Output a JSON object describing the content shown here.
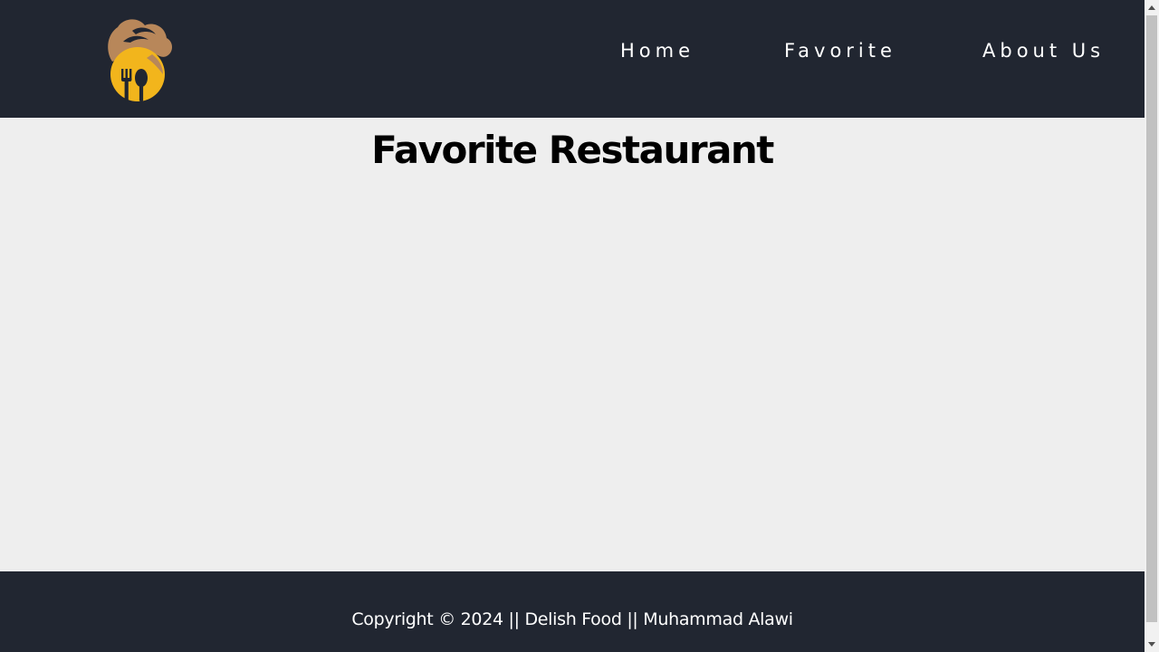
{
  "brand": {
    "logo_icon": "chef-hat-fork-spoon-logo",
    "colors": {
      "logo_hat": "#B8875A",
      "logo_plate": "#F2B51C",
      "logo_dark": "#212631"
    }
  },
  "nav": {
    "items": [
      {
        "label": "Home"
      },
      {
        "label": "Favorite"
      },
      {
        "label": "About Us"
      }
    ]
  },
  "main": {
    "title": "Favorite Restaurant"
  },
  "footer": {
    "copyright": "Copyright © 2024 || Delish Food || Muhammad Alawi"
  },
  "theme": {
    "navbar_bg": "#212631",
    "page_bg": "#EEEEEE",
    "text_light": "#FFFFFF",
    "text_dark": "#000000"
  }
}
